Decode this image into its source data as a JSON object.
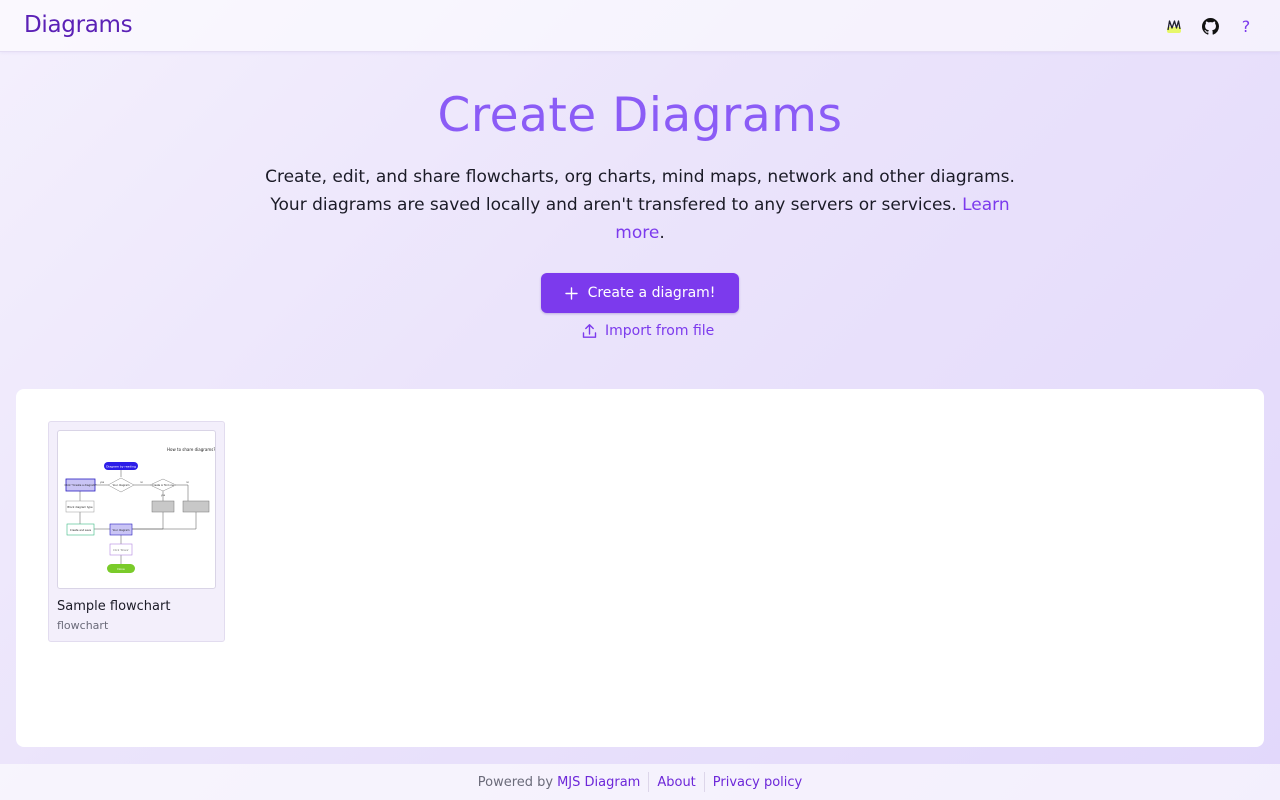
{
  "header": {
    "brand": "Diagrams",
    "icons": [
      "mjs-logo-icon",
      "github-icon",
      "help-icon"
    ],
    "help_glyph": "?"
  },
  "hero": {
    "title": "Create Diagrams",
    "description": "Create, edit, and share flowcharts, org charts, mind maps, network and other diagrams. Your diagrams are saved locally and aren't transfered to any servers or services.",
    "learn_more": "Learn more",
    "period": "."
  },
  "actions": {
    "create_label": "Create a diagram!",
    "import_label": "Import from file"
  },
  "diagrams": [
    {
      "title": "Sample flowchart",
      "type": "flowchart",
      "thumbnail": {
        "heading": "How to share diagrams?",
        "nodes": [
          "Diagram by reading",
          "Click \"Create a diagram\"",
          "Your diagram",
          "Create or find one",
          "Block diagram type",
          "Create and save",
          "Your diagram",
          "Click 'Share'",
          "Done"
        ],
        "edge_labels": [
          "yes",
          "no",
          "yes",
          "no"
        ]
      }
    }
  ],
  "footer": {
    "powered_by": "Powered by",
    "mjs_link": "MJS Diagram",
    "about": "About",
    "privacy": "Privacy policy"
  },
  "colors": {
    "accent": "#7c3aed",
    "title": "#8b5cf6",
    "brand": "#5b21b6"
  }
}
